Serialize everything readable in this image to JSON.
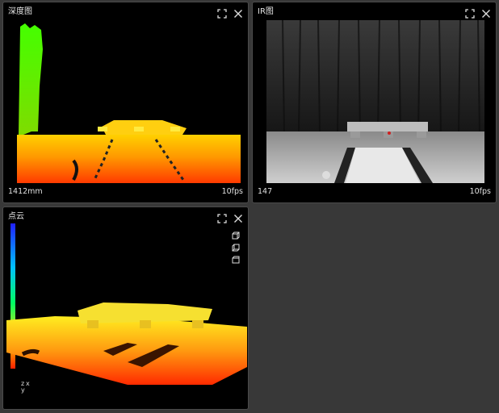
{
  "panels": {
    "depth": {
      "title": "深度图",
      "footer_left": "1412mm",
      "footer_right": "10fps"
    },
    "ir": {
      "title": "IR图",
      "footer_left": "147",
      "footer_right": "10fps"
    },
    "cloud": {
      "title": "点云",
      "axis_z": "z",
      "axis_x": "x",
      "axis_y": "y"
    }
  },
  "icons": {
    "expand": "expand-icon",
    "close": "close-icon",
    "view_front": "view-front-icon",
    "view_side": "view-side-icon",
    "view_top": "view-top-icon"
  },
  "colors": {
    "background": "#383838",
    "panel": "#000000",
    "colormap_near": "#ff2200",
    "colormap_far": "#00ff44"
  }
}
